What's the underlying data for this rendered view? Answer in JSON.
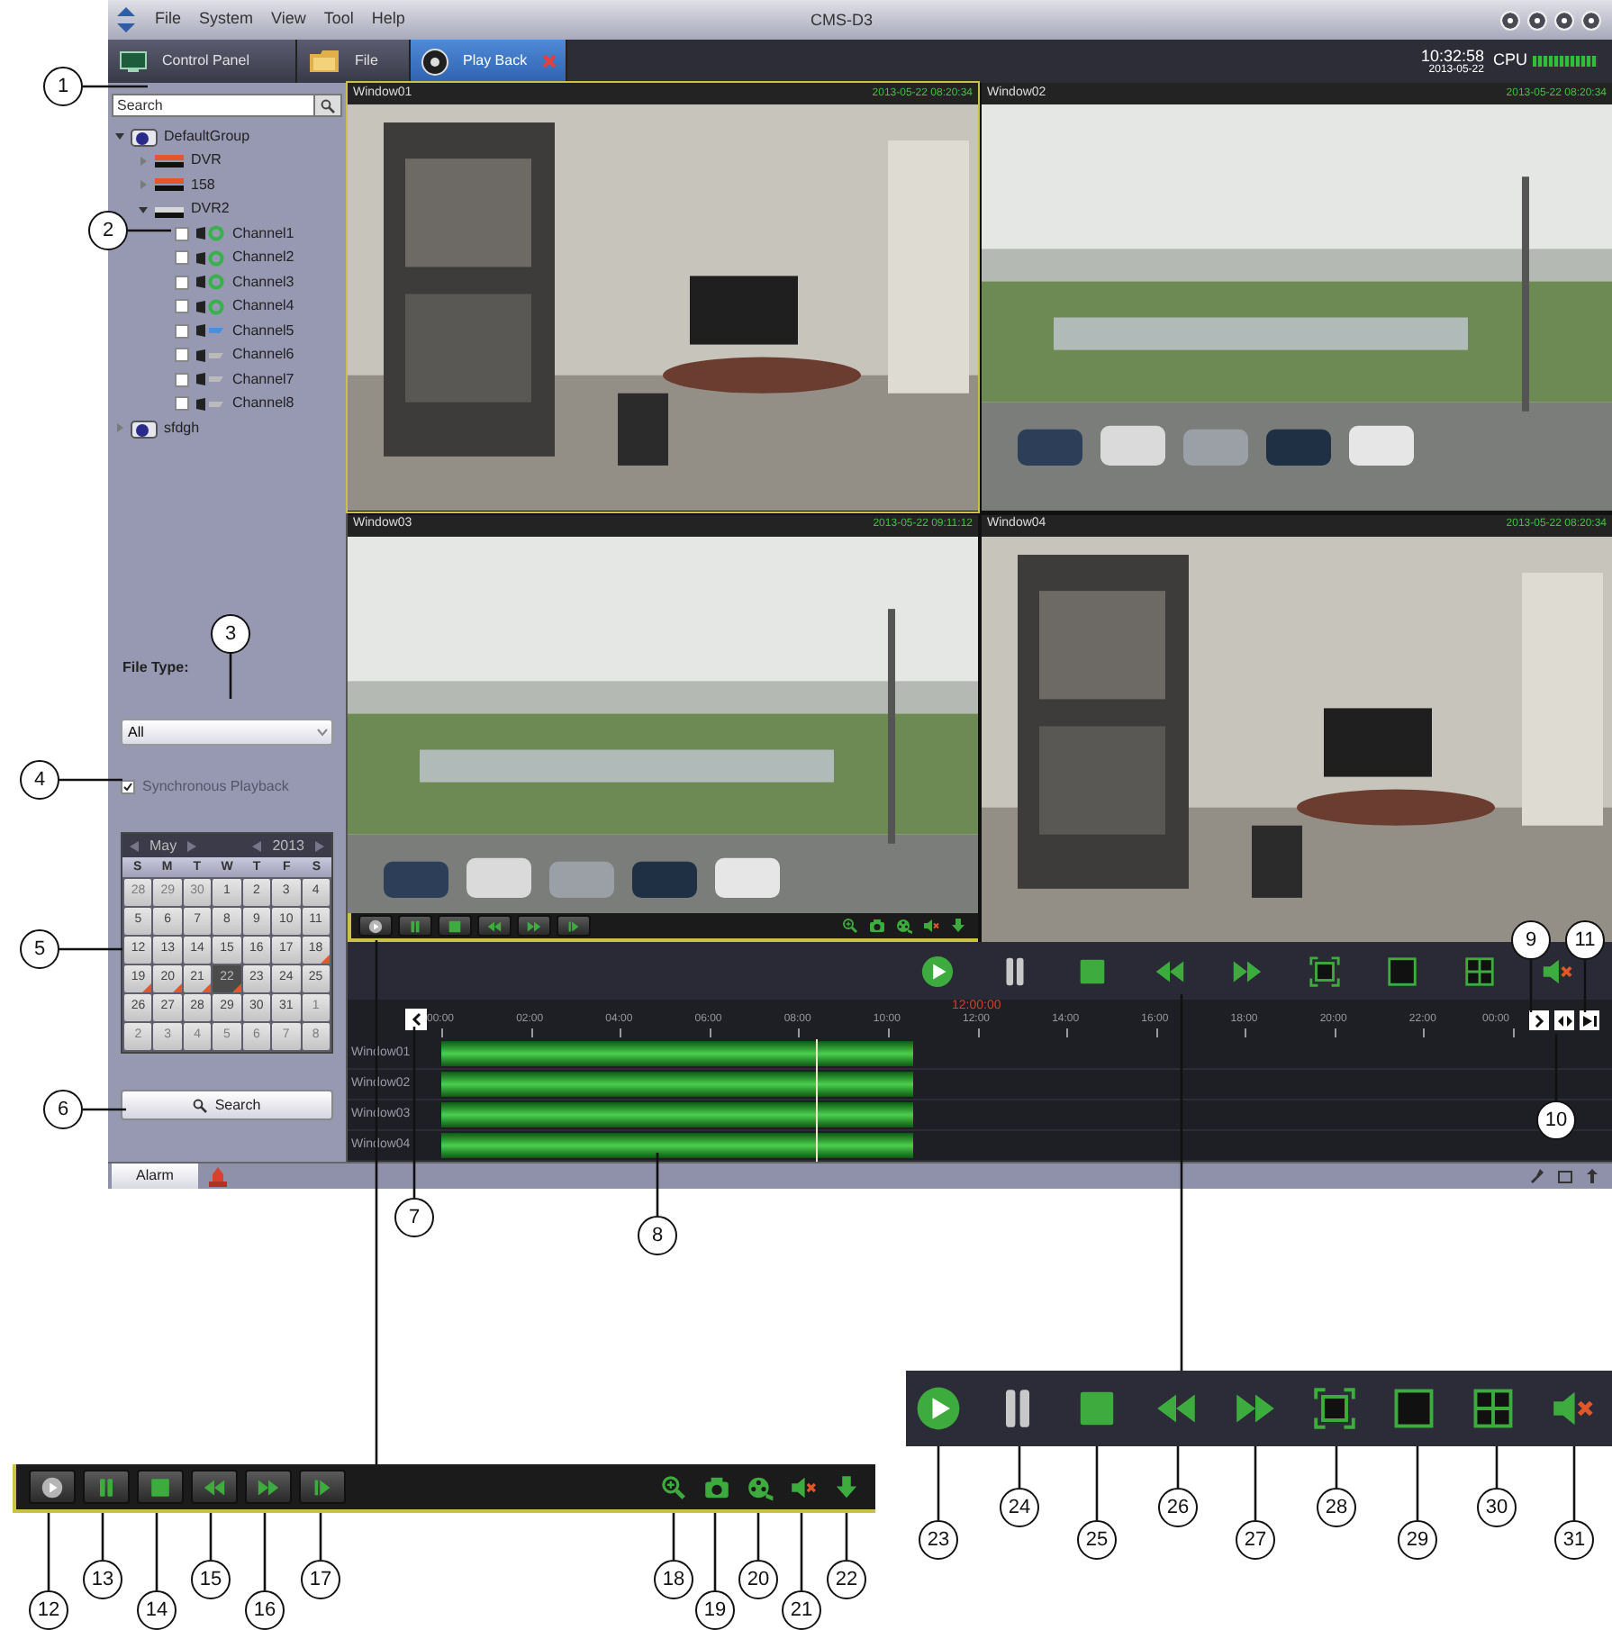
{
  "window": {
    "title": "CMS-D3",
    "menu": [
      "File",
      "System",
      "View",
      "Tool",
      "Help"
    ]
  },
  "tabs": [
    {
      "label": "Control Panel",
      "selected": false,
      "closable": false
    },
    {
      "label": "File",
      "selected": false,
      "closable": false
    },
    {
      "label": "Play Back",
      "selected": true,
      "closable": true
    }
  ],
  "clock": {
    "time": "10:32:58",
    "date": "2013-05-22"
  },
  "cpu": {
    "label": "CPU",
    "level": 1
  },
  "sidebar": {
    "search": {
      "placeholder": "Search"
    },
    "tree": [
      {
        "label": "DefaultGroup",
        "kind": "group",
        "expanded": true,
        "children": [
          {
            "label": "DVR",
            "kind": "dvr",
            "expanded": false,
            "connected": false
          },
          {
            "label": "158",
            "kind": "dvr",
            "expanded": false,
            "connected": false
          },
          {
            "label": "DVR2",
            "kind": "dvr",
            "expanded": true,
            "connected": true,
            "children": [
              {
                "label": "Channel1",
                "kind": "channel",
                "checked": false,
                "online": true,
                "color": "#37b24a"
              },
              {
                "label": "Channel2",
                "kind": "channel",
                "checked": false,
                "online": true,
                "color": "#37b24a"
              },
              {
                "label": "Channel3",
                "kind": "channel",
                "checked": false,
                "online": true,
                "color": "#37b24a"
              },
              {
                "label": "Channel4",
                "kind": "channel",
                "checked": false,
                "online": true,
                "color": "#37b24a"
              },
              {
                "label": "Channel5",
                "kind": "channel",
                "checked": false,
                "online": false,
                "color": "#4a8fd8"
              },
              {
                "label": "Channel6",
                "kind": "channel",
                "checked": false,
                "online": false,
                "color": "#bbbbbb"
              },
              {
                "label": "Channel7",
                "kind": "channel",
                "checked": false,
                "online": false,
                "color": "#bbbbbb"
              },
              {
                "label": "Channel8",
                "kind": "channel",
                "checked": false,
                "online": false,
                "color": "#bbbbbb"
              }
            ]
          }
        ]
      },
      {
        "label": "sfdgh",
        "kind": "group",
        "expanded": false
      }
    ],
    "file_type": {
      "label": "File Type:",
      "value": "All"
    },
    "sync": {
      "label": "Synchronous Playback",
      "checked": true,
      "disabled": true
    },
    "calendar": {
      "month": "May",
      "year": "2013",
      "weekdays": [
        "S",
        "M",
        "T",
        "W",
        "T",
        "F",
        "S"
      ],
      "days": [
        {
          "label": "28",
          "in_month": false,
          "has_record": false,
          "selected": false
        },
        {
          "label": "29",
          "in_month": false,
          "has_record": false,
          "selected": false
        },
        {
          "label": "30",
          "in_month": false,
          "has_record": false,
          "selected": false
        },
        {
          "label": "1",
          "in_month": true,
          "has_record": false,
          "selected": false
        },
        {
          "label": "2",
          "in_month": true,
          "has_record": false,
          "selected": false
        },
        {
          "label": "3",
          "in_month": true,
          "has_record": false,
          "selected": false
        },
        {
          "label": "4",
          "in_month": true,
          "has_record": false,
          "selected": false
        },
        {
          "label": "5",
          "in_month": true,
          "has_record": false,
          "selected": false
        },
        {
          "label": "6",
          "in_month": true,
          "has_record": false,
          "selected": false
        },
        {
          "label": "7",
          "in_month": true,
          "has_record": false,
          "selected": false
        },
        {
          "label": "8",
          "in_month": true,
          "has_record": false,
          "selected": false
        },
        {
          "label": "9",
          "in_month": true,
          "has_record": false,
          "selected": false
        },
        {
          "label": "10",
          "in_month": true,
          "has_record": false,
          "selected": false
        },
        {
          "label": "11",
          "in_month": true,
          "has_record": false,
          "selected": false
        },
        {
          "label": "12",
          "in_month": true,
          "has_record": false,
          "selected": false
        },
        {
          "label": "13",
          "in_month": true,
          "has_record": false,
          "selected": false
        },
        {
          "label": "14",
          "in_month": true,
          "has_record": false,
          "selected": false
        },
        {
          "label": "15",
          "in_month": true,
          "has_record": false,
          "selected": false
        },
        {
          "label": "16",
          "in_month": true,
          "has_record": false,
          "selected": false
        },
        {
          "label": "17",
          "in_month": true,
          "has_record": false,
          "selected": false
        },
        {
          "label": "18",
          "in_month": true,
          "has_record": true,
          "selected": false
        },
        {
          "label": "19",
          "in_month": true,
          "has_record": true,
          "selected": false
        },
        {
          "label": "20",
          "in_month": true,
          "has_record": true,
          "selected": false
        },
        {
          "label": "21",
          "in_month": true,
          "has_record": true,
          "selected": false
        },
        {
          "label": "22",
          "in_month": true,
          "has_record": true,
          "selected": true
        },
        {
          "label": "23",
          "in_month": true,
          "has_record": false,
          "selected": false
        },
        {
          "label": "24",
          "in_month": true,
          "has_record": false,
          "selected": false
        },
        {
          "label": "25",
          "in_month": true,
          "has_record": false,
          "selected": false
        },
        {
          "label": "26",
          "in_month": true,
          "has_record": false,
          "selected": false
        },
        {
          "label": "27",
          "in_month": true,
          "has_record": false,
          "selected": false
        },
        {
          "label": "28",
          "in_month": true,
          "has_record": false,
          "selected": false
        },
        {
          "label": "29",
          "in_month": true,
          "has_record": false,
          "selected": false
        },
        {
          "label": "30",
          "in_month": true,
          "has_record": false,
          "selected": false
        },
        {
          "label": "31",
          "in_month": true,
          "has_record": false,
          "selected": false
        },
        {
          "label": "1",
          "in_month": false,
          "has_record": false,
          "selected": false
        },
        {
          "label": "2",
          "in_month": false,
          "has_record": false,
          "selected": false
        },
        {
          "label": "3",
          "in_month": false,
          "has_record": false,
          "selected": false
        },
        {
          "label": "4",
          "in_month": false,
          "has_record": false,
          "selected": false
        },
        {
          "label": "5",
          "in_month": false,
          "has_record": false,
          "selected": false
        },
        {
          "label": "6",
          "in_month": false,
          "has_record": false,
          "selected": false
        },
        {
          "label": "7",
          "in_month": false,
          "has_record": false,
          "selected": false
        },
        {
          "label": "8",
          "in_month": false,
          "has_record": false,
          "selected": false
        }
      ]
    },
    "search_button": "Search"
  },
  "windows": [
    {
      "title": "Window01",
      "timestamp": "2013-05-22 08:20:34",
      "selected": true,
      "show_toolbar": false
    },
    {
      "title": "Window02",
      "timestamp": "2013-05-22 08:20:34",
      "selected": false,
      "show_toolbar": false
    },
    {
      "title": "Window03",
      "timestamp": "2013-05-22 09:11:12",
      "selected": false,
      "show_toolbar": true
    },
    {
      "title": "Window04",
      "timestamp": "2013-05-22 08:20:34",
      "selected": false,
      "show_toolbar": false
    }
  ],
  "timeline": {
    "cursor_label": "12:00:00",
    "ticks": [
      "00:00",
      "02:00",
      "04:00",
      "06:00",
      "08:00",
      "10:00",
      "12:00",
      "14:00",
      "16:00",
      "18:00",
      "20:00",
      "22:00",
      "00:00"
    ],
    "rows": [
      {
        "label": "Window01",
        "level": 0.44
      },
      {
        "label": "Window02",
        "level": 0.44
      },
      {
        "label": "Window03",
        "level": 0.44
      },
      {
        "label": "Window04",
        "level": 0.44
      }
    ]
  },
  "status_bar": {
    "alarm_tab": "Alarm"
  },
  "callouts": [
    "1",
    "2",
    "3",
    "4",
    "5",
    "6",
    "7",
    "8",
    "9",
    "10",
    "11",
    "12",
    "13",
    "14",
    "15",
    "16",
    "17",
    "18",
    "19",
    "20",
    "21",
    "22",
    "23",
    "24",
    "25",
    "26",
    "27",
    "28",
    "29",
    "30",
    "31"
  ]
}
